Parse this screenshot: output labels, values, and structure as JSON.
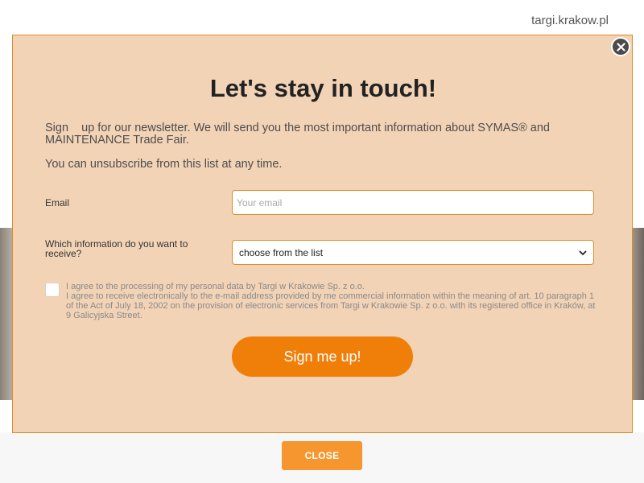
{
  "site": {
    "link": "targi.krakow.pl"
  },
  "modal": {
    "title": "Let's stay in touch!",
    "intro_line1": "Sign    up for our newsletter. We will send you the most important information about SYMAS® and",
    "intro_line2": "MAINTENANCE Trade Fair.",
    "unsubscribe": "You can unsubscribe from this list at any time.",
    "email": {
      "label": "Email",
      "placeholder": "Your email",
      "value": ""
    },
    "info": {
      "label": "Which information do you want to receive?",
      "selected": "choose from the list"
    },
    "consent": {
      "checked": false,
      "line1": "I agree to the processing of my personal data by Targi w Krakowie Sp. z o.o.",
      "line2": "I agree to receive electronically to the e-mail address provided by me commercial information within the meaning of art. 10 paragraph 1 of the Act of July 18, 2002 on the provision of electronic services from Targi w Krakowie Sp. z o.o. with its registered office in Kraków, at 9 Galicyjska Street."
    },
    "submit_label": "Sign me up!",
    "close_icon": "close-x-icon"
  },
  "footer": {
    "close_label": "CLOSE"
  },
  "colors": {
    "accent": "#f07f0a",
    "modal_bg": "#f2d3b6",
    "border": "#e08a24",
    "close_btn": "#f5962f"
  }
}
